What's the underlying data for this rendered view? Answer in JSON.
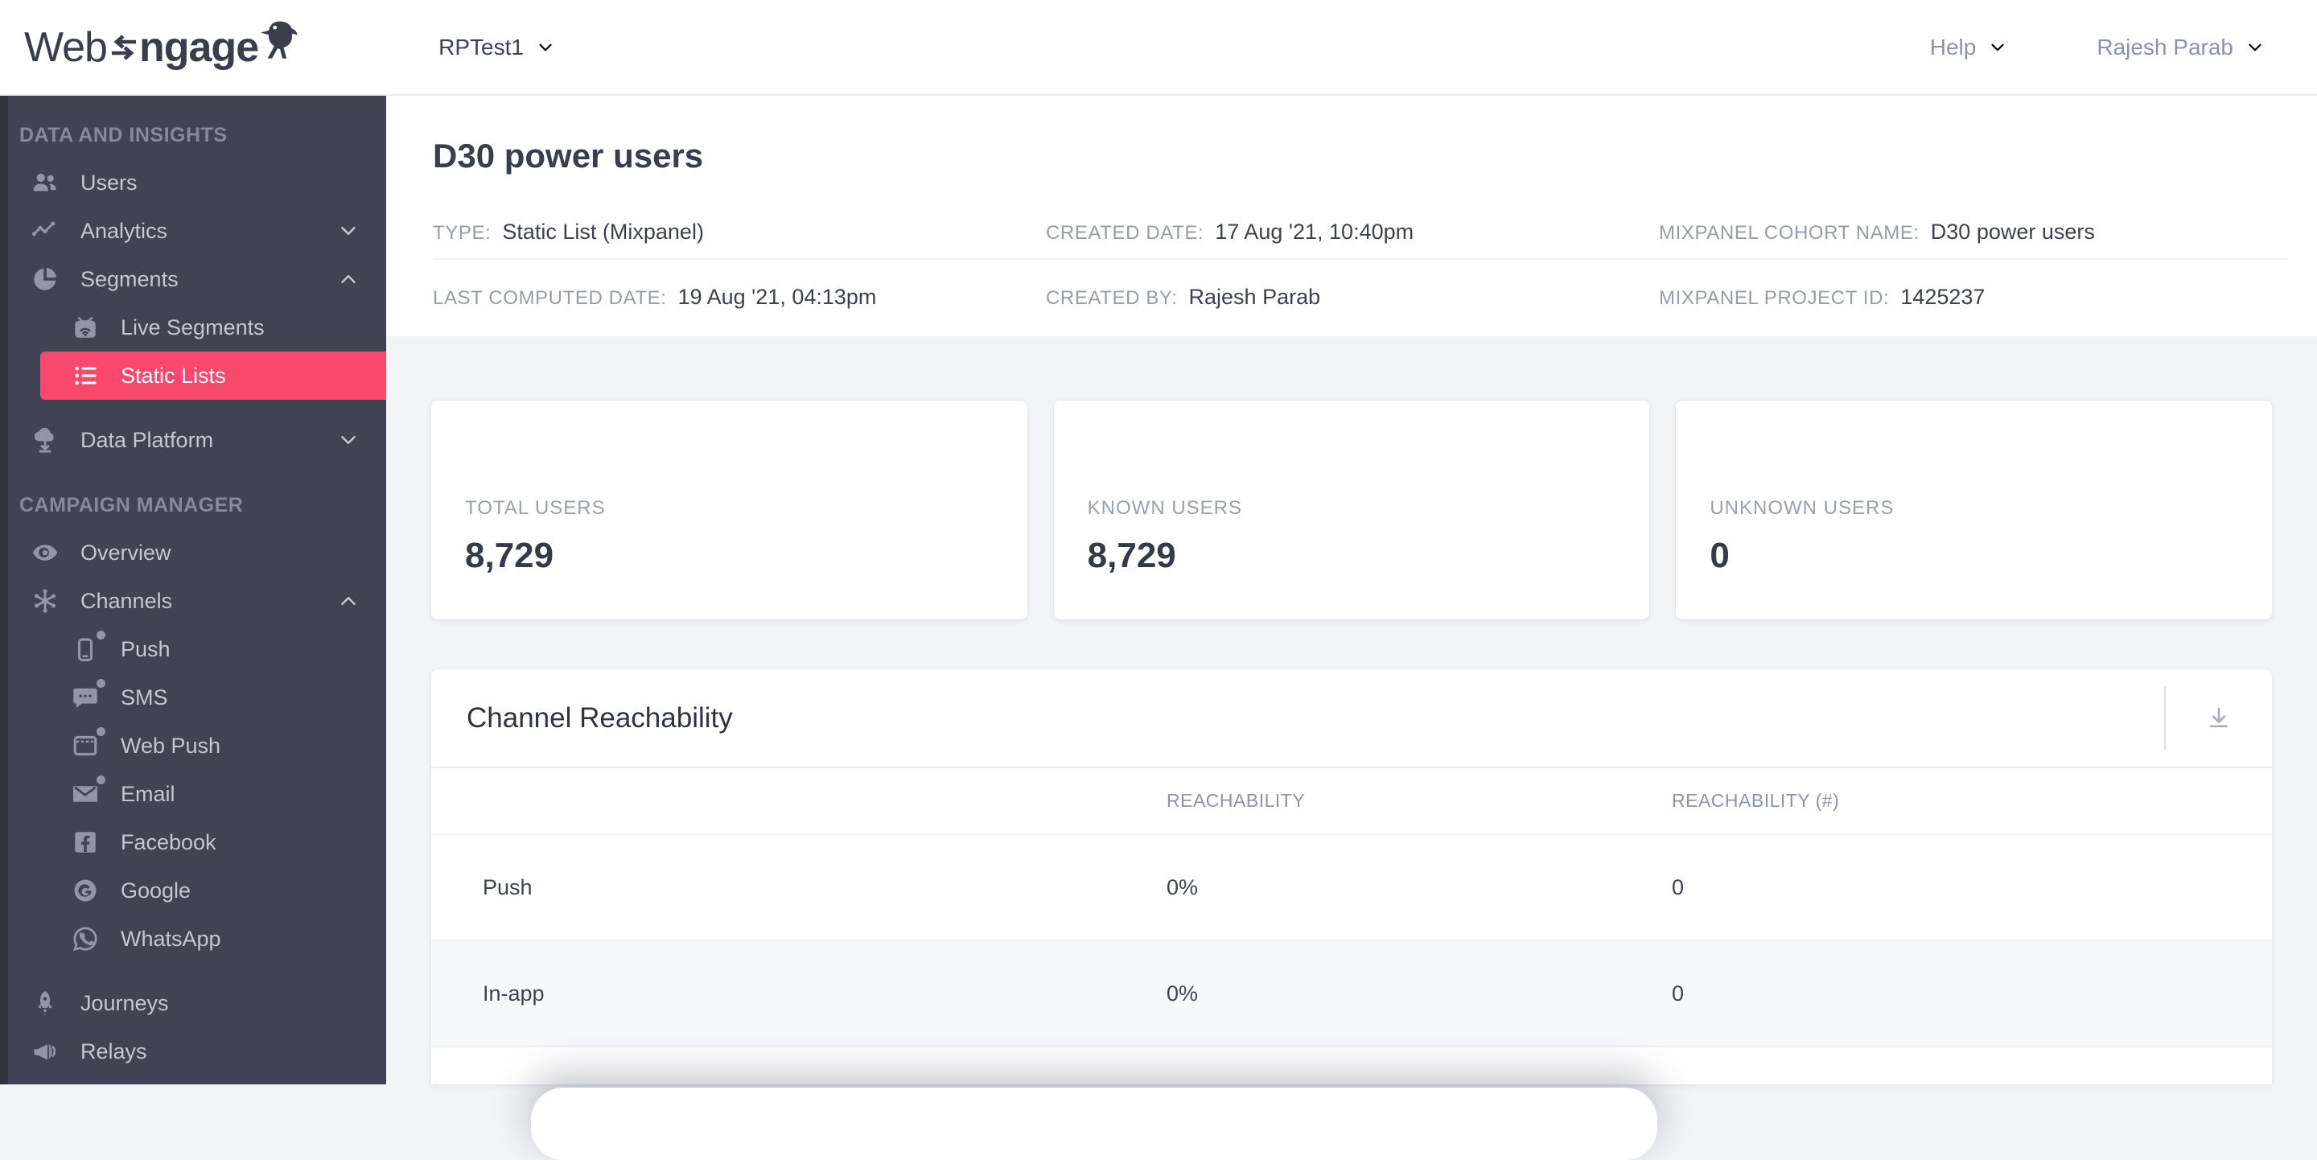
{
  "topbar": {
    "logo_web": "Web",
    "logo_ngage": "ngage",
    "project": "RPTest1",
    "help": "Help",
    "user": "Rajesh Parab"
  },
  "sidebar": {
    "section1": "DATA AND INSIGHTS",
    "section2": "CAMPAIGN MANAGER",
    "items": {
      "users": "Users",
      "analytics": "Analytics",
      "segments": "Segments",
      "live_segments": "Live Segments",
      "static_lists": "Static Lists",
      "data_platform": "Data Platform",
      "overview": "Overview",
      "channels": "Channels",
      "push": "Push",
      "sms": "SMS",
      "web_push": "Web Push",
      "email": "Email",
      "facebook": "Facebook",
      "google": "Google",
      "whatsapp": "WhatsApp",
      "journeys": "Journeys",
      "relays": "Relays"
    }
  },
  "page": {
    "title": "D30 power users",
    "meta": {
      "type_label": "TYPE:",
      "type_value": "Static List (Mixpanel)",
      "created_date_label": "CREATED DATE:",
      "created_date_value": "17 Aug '21, 10:40pm",
      "cohort_label": "MIXPANEL COHORT NAME:",
      "cohort_value": "D30 power users",
      "computed_label": "LAST COMPUTED DATE:",
      "computed_value": "19 Aug '21, 04:13pm",
      "created_by_label": "CREATED BY:",
      "created_by_value": "Rajesh Parab",
      "project_id_label": "MIXPANEL PROJECT ID:",
      "project_id_value": "1425237"
    }
  },
  "stats": {
    "total": {
      "label": "TOTAL USERS",
      "value": "8,729"
    },
    "known": {
      "label": "KNOWN USERS",
      "value": "8,729"
    },
    "unknown": {
      "label": "UNKNOWN USERS",
      "value": "0"
    }
  },
  "reachability": {
    "title": "Channel Reachability",
    "columns": {
      "reach": "REACHABILITY",
      "reach_count": "REACHABILITY (#)"
    },
    "rows": [
      {
        "channel": "Push",
        "reach": "0%",
        "count": "0"
      },
      {
        "channel": "In-app",
        "reach": "0%",
        "count": "0"
      }
    ]
  },
  "colors": {
    "accent_pink": "#f8486e",
    "sidebar_bg": "#404353",
    "page_bg": "#f2f4f7"
  }
}
